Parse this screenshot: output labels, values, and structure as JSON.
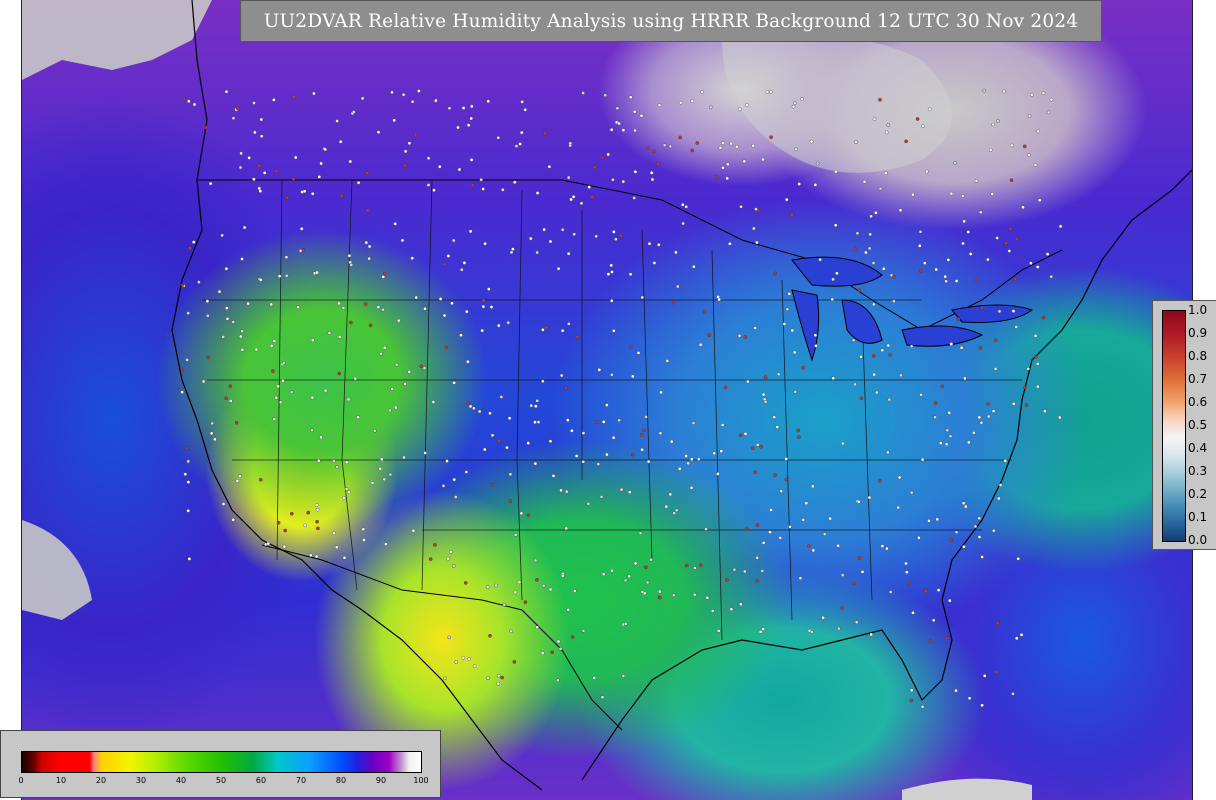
{
  "title": "UU2DVAR Relative Humidity Analysis using HRRR Background 12 UTC 30 Nov 2024",
  "colors": {
    "title_bar_bg": "#8e8e8e",
    "title_text": "#ffffff",
    "legend_bg": "#c7c7c7",
    "land_outline": "#000000",
    "obs_dot_fill": "#ffffff",
    "obs_dot_outline": "#333333"
  },
  "rh_colorbar": {
    "ticks": [
      "0",
      "10",
      "20",
      "30",
      "40",
      "50",
      "60",
      "70",
      "80",
      "90",
      "100"
    ]
  },
  "fraction_colorbar": {
    "ticks": [
      "1.0",
      "0.9",
      "0.8",
      "0.7",
      "0.6",
      "0.5",
      "0.4",
      "0.3",
      "0.2",
      "0.1",
      "0.0"
    ]
  },
  "icons": {
    "observation_marker": "small-circle-icon"
  }
}
